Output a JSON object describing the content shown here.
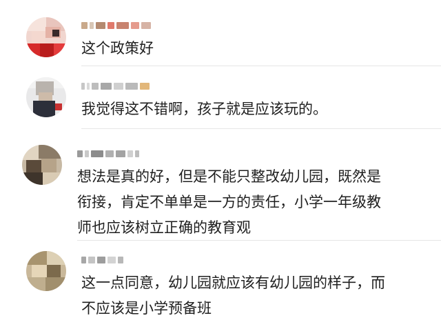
{
  "comments": [
    {
      "username": "",
      "lines": [
        "这个政策好"
      ]
    },
    {
      "username": "",
      "lines": [
        "我觉得这不错啊，孩子就是应该玩的。"
      ]
    },
    {
      "username": "",
      "lines": [
        "想法是真的好，但是不能只整改幼儿园，既然是",
        "衔接，肯定不单单是一方的责任，小学一年级教",
        "师也应该树立正确的教育观"
      ]
    },
    {
      "username": "",
      "lines": [
        "这一点同意，幼儿园就应该有幼儿园的样子，而",
        "不应该是小学预备班"
      ]
    }
  ],
  "colors": {
    "text": "#1f1f1f",
    "username_blur": "#9aa0a6",
    "divider": "#e6e6e6"
  },
  "icons": [
    "avatar-pixelated",
    "username-pixelated"
  ]
}
